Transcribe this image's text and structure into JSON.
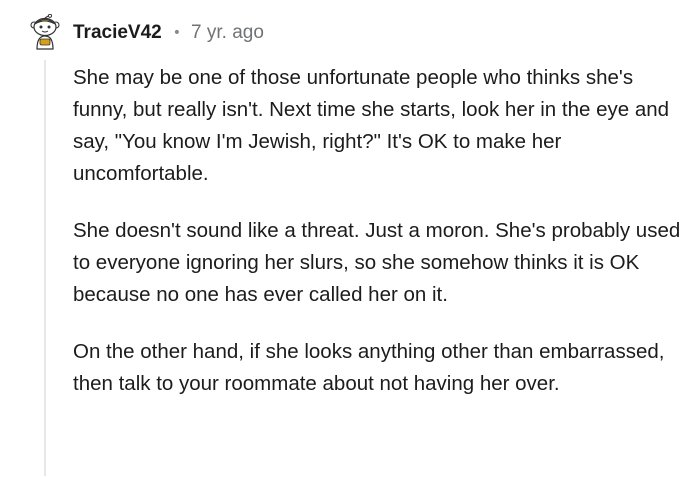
{
  "comment": {
    "author": "TracieV42",
    "separator": "•",
    "time_ago": "7 yr. ago",
    "paragraphs": [
      "She may be one of those unfortunate people who thinks she's funny, but really isn't. Next time she starts, look her in the eye and say, \"You know I'm Jewish, right?\" It's OK to make her uncomfortable.",
      "She doesn't sound like a threat. Just a moron. She's probably used to everyone ignoring her slurs, so she somehow thinks it is OK because no one has ever called her on it.",
      "On the other hand, if she looks anything other than embarrassed, then talk to your roommate about not having her over."
    ]
  },
  "colors": {
    "text": "#1c1c1c",
    "meta": "#6f7375",
    "thread_line": "#e5e7e8",
    "avatar_accent": "#d4a017"
  },
  "icons": {
    "avatar": "snoo-avatar-icon"
  }
}
